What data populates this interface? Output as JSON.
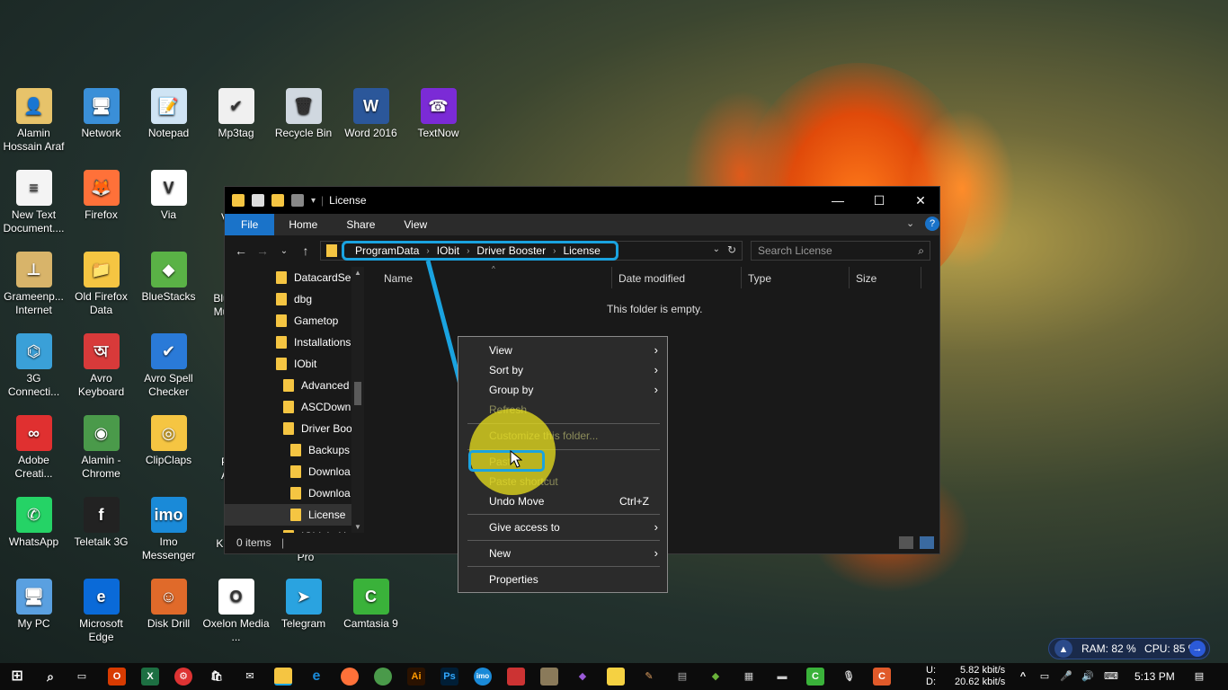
{
  "desktop": {
    "icons": [
      {
        "label": "Alamin Hossain Araf",
        "color": "#e7c36a",
        "glyph": "👤"
      },
      {
        "label": "Network",
        "color": "#3a8fd8",
        "glyph": "🖥"
      },
      {
        "label": "Notepad",
        "color": "#cfe4f4",
        "glyph": "📝"
      },
      {
        "label": "Mp3tag",
        "color": "#f0f0f0",
        "glyph": "✔"
      },
      {
        "label": "Recycle Bin",
        "color": "#d0d8e0",
        "glyph": "🗑"
      },
      {
        "label": "Word 2016",
        "color": "#2b579a",
        "glyph": "W"
      },
      {
        "label": "TextNow",
        "color": "#7b2bd6",
        "glyph": "☎"
      },
      {
        "label": "New Text Document....",
        "color": "#f4f4f4",
        "glyph": "≡"
      },
      {
        "label": "Firefox",
        "color": "#ff7139",
        "glyph": "🦊"
      },
      {
        "label": "Via",
        "color": "#ffffff",
        "glyph": "V"
      },
      {
        "label": "Grameenp... Internet",
        "color": "#d8b46a",
        "glyph": "⊥"
      },
      {
        "label": "Old Firefox Data",
        "color": "#f5c542",
        "glyph": "📁"
      },
      {
        "label": "BlueStacks",
        "color": "#5ab246",
        "glyph": "◆"
      },
      {
        "label": "3G Connecti...",
        "color": "#3aa0d8",
        "glyph": "⌬"
      },
      {
        "label": "Avro Keyboard",
        "color": "#d83a3a",
        "glyph": "অ"
      },
      {
        "label": "Avro Spell Checker",
        "color": "#2a7ad8",
        "glyph": "✔"
      },
      {
        "label": "Adobe Creati...",
        "color": "#e03030",
        "glyph": "∞"
      },
      {
        "label": "Alamin - Chrome",
        "color": "#4a9a4a",
        "glyph": "◉"
      },
      {
        "label": "ClipClaps",
        "color": "#f5c542",
        "glyph": "◎"
      },
      {
        "label": "WhatsApp",
        "color": "#25d366",
        "glyph": "✆"
      },
      {
        "label": "Teletalk 3G",
        "color": "#222222",
        "glyph": "f"
      },
      {
        "label": "Imo Messenger",
        "color": "#1a8ad8",
        "glyph": "imo"
      },
      {
        "label": "My PC",
        "color": "#5aa0e0",
        "glyph": "🖥"
      },
      {
        "label": "Microsoft Edge",
        "color": "#0a6ad8",
        "glyph": "e"
      },
      {
        "label": "Disk Drill",
        "color": "#e06a2a",
        "glyph": "☺"
      },
      {
        "label": "Oxelon Media ...",
        "color": "#ffffff",
        "glyph": "O"
      },
      {
        "label": "Telegram",
        "color": "#2aa3e0",
        "glyph": "➤"
      },
      {
        "label": "Camtasia 9",
        "color": "#3ab23a",
        "glyph": "C"
      }
    ],
    "partial_labels": [
      "Blu",
      "Mu",
      "P",
      "A",
      "KI",
      "Pro",
      "V"
    ]
  },
  "explorer": {
    "title": "License",
    "ribbon_tabs": [
      "File",
      "Home",
      "Share",
      "View"
    ],
    "breadcrumb": [
      "ProgramData",
      "IObit",
      "Driver Booster",
      "License"
    ],
    "breadcrumb_sep": "›",
    "search_placeholder": "Search License",
    "tree": [
      {
        "label": "DatacardSer",
        "indent": 0
      },
      {
        "label": "dbg",
        "indent": 0
      },
      {
        "label": "Gametop",
        "indent": 0
      },
      {
        "label": "Installations",
        "indent": 0
      },
      {
        "label": "IObit",
        "indent": 0
      },
      {
        "label": "Advanced",
        "indent": 1
      },
      {
        "label": "ASCDown",
        "indent": 1
      },
      {
        "label": "Driver Boo",
        "indent": 1
      },
      {
        "label": "Backups",
        "indent": 2
      },
      {
        "label": "Downloa",
        "indent": 2
      },
      {
        "label": "Downloa",
        "indent": 2
      },
      {
        "label": "License",
        "indent": 2,
        "selected": true
      },
      {
        "label": "IObit i...U",
        "indent": 1
      }
    ],
    "columns": [
      "Name",
      "Date modified",
      "Type",
      "Size"
    ],
    "empty_message": "This folder is empty.",
    "status": "0 items"
  },
  "context_menu": {
    "items": [
      {
        "label": "View",
        "submenu": true
      },
      {
        "label": "Sort by",
        "submenu": true
      },
      {
        "label": "Group by",
        "submenu": true
      },
      {
        "label": "Refresh",
        "disabled": true
      },
      {
        "label": "Customize this folder...",
        "disabled": true
      },
      {
        "label": "Paste",
        "disabled": true
      },
      {
        "label": "Paste shortcut",
        "disabled": true
      },
      {
        "label": "Undo Move",
        "shortcut": "Ctrl+Z"
      },
      {
        "label": "Give access to",
        "submenu": true
      },
      {
        "label": "New",
        "submenu": true
      },
      {
        "label": "Properties"
      }
    ]
  },
  "sysmon": {
    "ram": "RAM: 82 %",
    "cpu": "CPU: 85 %"
  },
  "taskbar": {
    "net_up_label": "U:",
    "net_down_label": "D:",
    "net_up": "5.82 kbit/s",
    "net_down": "20.62 kbit/s",
    "time": "5:13 PM",
    "accent": "#1aa3e0"
  }
}
